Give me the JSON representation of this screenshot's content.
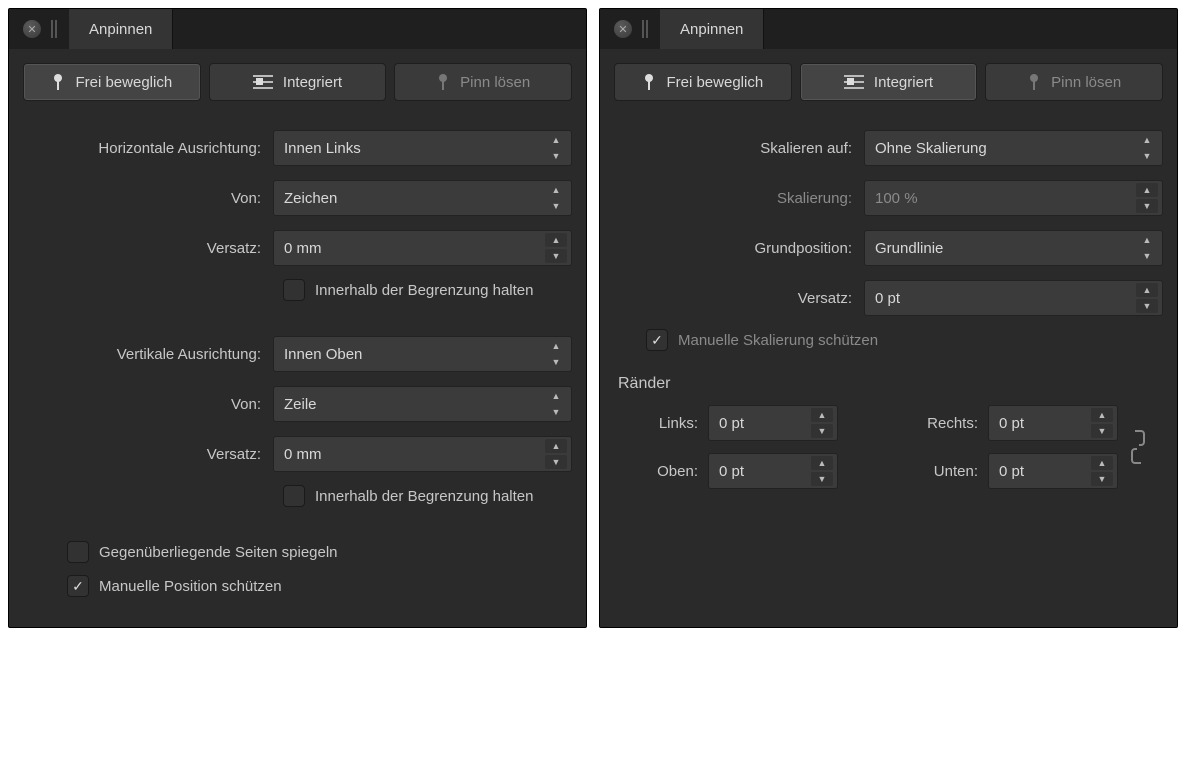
{
  "panelA": {
    "tabTitle": "Anpinnen",
    "modes": {
      "free": "Frei beweglich",
      "inline": "Integriert",
      "unpin": "Pinn lösen"
    },
    "horiz": {
      "align_label": "Horizontale Ausrichtung:",
      "align_value": "Innen Links",
      "from_label": "Von:",
      "from_value": "Zeichen",
      "offset_label": "Versatz:",
      "offset_value": "0 mm",
      "keep_label": "Innerhalb der Begrenzung halten"
    },
    "vert": {
      "align_label": "Vertikale Ausrichtung:",
      "align_value": "Innen Oben",
      "from_label": "Von:",
      "from_value": "Zeile",
      "offset_label": "Versatz:",
      "offset_value": "0 mm",
      "keep_label": "Innerhalb der Begrenzung halten"
    },
    "mirror_label": "Gegenüberliegende Seiten spiegeln",
    "protect_label": "Manuelle Position schützen"
  },
  "panelB": {
    "tabTitle": "Anpinnen",
    "modes": {
      "free": "Frei beweglich",
      "inline": "Integriert",
      "unpin": "Pinn lösen"
    },
    "scale_to_label": "Skalieren auf:",
    "scale_to_value": "Ohne Skalierung",
    "scaling_label": "Skalierung:",
    "scaling_value": "100 %",
    "base_label": "Grundposition:",
    "base_value": "Grundlinie",
    "offset_label": "Versatz:",
    "offset_value": "0 pt",
    "protect_scale_label": "Manuelle Skalierung schützen",
    "margins_title": "Ränder",
    "margins": {
      "left_label": "Links:",
      "left_value": "0 pt",
      "right_label": "Rechts:",
      "right_value": "0 pt",
      "top_label": "Oben:",
      "top_value": "0 pt",
      "bottom_label": "Unten:",
      "bottom_value": "0 pt"
    }
  }
}
